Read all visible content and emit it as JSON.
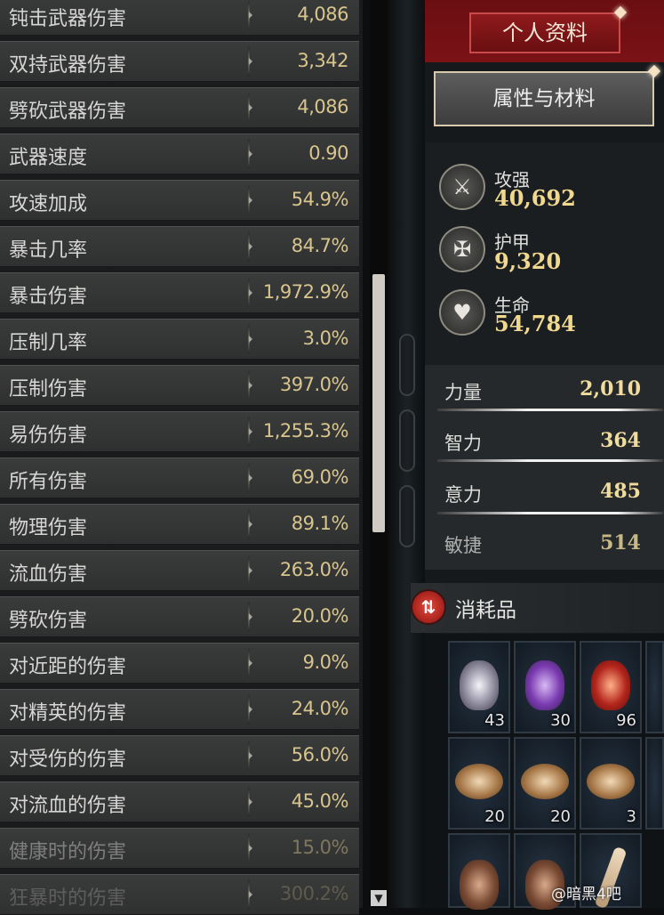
{
  "stats": [
    {
      "label": "钝击武器伤害",
      "value": "4,086"
    },
    {
      "label": "双持武器伤害",
      "value": "3,342"
    },
    {
      "label": "劈砍武器伤害",
      "value": "4,086"
    },
    {
      "label": "武器速度",
      "value": "0.90"
    },
    {
      "label": "攻速加成",
      "value": "54.9%"
    },
    {
      "label": "暴击几率",
      "value": "84.7%"
    },
    {
      "label": "暴击伤害",
      "value": "1,972.9%"
    },
    {
      "label": "压制几率",
      "value": "3.0%"
    },
    {
      "label": "压制伤害",
      "value": "397.0%"
    },
    {
      "label": "易伤伤害",
      "value": "1,255.3%"
    },
    {
      "label": "所有伤害",
      "value": "69.0%"
    },
    {
      "label": "物理伤害",
      "value": "89.1%"
    },
    {
      "label": "流血伤害",
      "value": "263.0%"
    },
    {
      "label": "劈砍伤害",
      "value": "20.0%"
    },
    {
      "label": "对近距的伤害",
      "value": "9.0%"
    },
    {
      "label": "对精英的伤害",
      "value": "24.0%"
    },
    {
      "label": "对受伤的伤害",
      "value": "56.0%"
    },
    {
      "label": "对流血的伤害",
      "value": "45.0%"
    },
    {
      "label": "健康时的伤害",
      "value": "15.0%"
    },
    {
      "label": "狂暴时的伤害",
      "value": "300.2%"
    }
  ],
  "scroll_down_icon": "▼",
  "profile_button": "个人资料",
  "attributes_button": "属性与材料",
  "summary": [
    {
      "label": "攻强",
      "value": "40,692",
      "icon": "swords-icon"
    },
    {
      "label": "护甲",
      "value": "9,320",
      "icon": "shield-icon"
    },
    {
      "label": "生命",
      "value": "54,784",
      "icon": "heart-icon"
    }
  ],
  "attributes": [
    {
      "label": "力量",
      "value": "2,010"
    },
    {
      "label": "智力",
      "value": "364"
    },
    {
      "label": "意力",
      "value": "485"
    },
    {
      "label": "敏捷",
      "value": "514"
    }
  ],
  "consumables_title": "消耗品",
  "consumables_icon": "⇅",
  "inventory": [
    {
      "name": "silver-elixir",
      "qty": "43"
    },
    {
      "name": "purple-elixir",
      "qty": "30"
    },
    {
      "name": "red-elixir",
      "qty": "96"
    },
    {
      "name": "incense-1",
      "qty": "20"
    },
    {
      "name": "incense-2",
      "qty": "20"
    },
    {
      "name": "incense-3",
      "qty": "3"
    },
    {
      "name": "egg-1",
      "qty": ""
    },
    {
      "name": "egg-2",
      "qty": ""
    },
    {
      "name": "bone",
      "qty": ""
    }
  ],
  "watermark": "@暗黑4吧",
  "colors": {
    "stat_value": "#d8c58e",
    "summary_value": "#f0d88e",
    "header_red": "#7a1216"
  }
}
